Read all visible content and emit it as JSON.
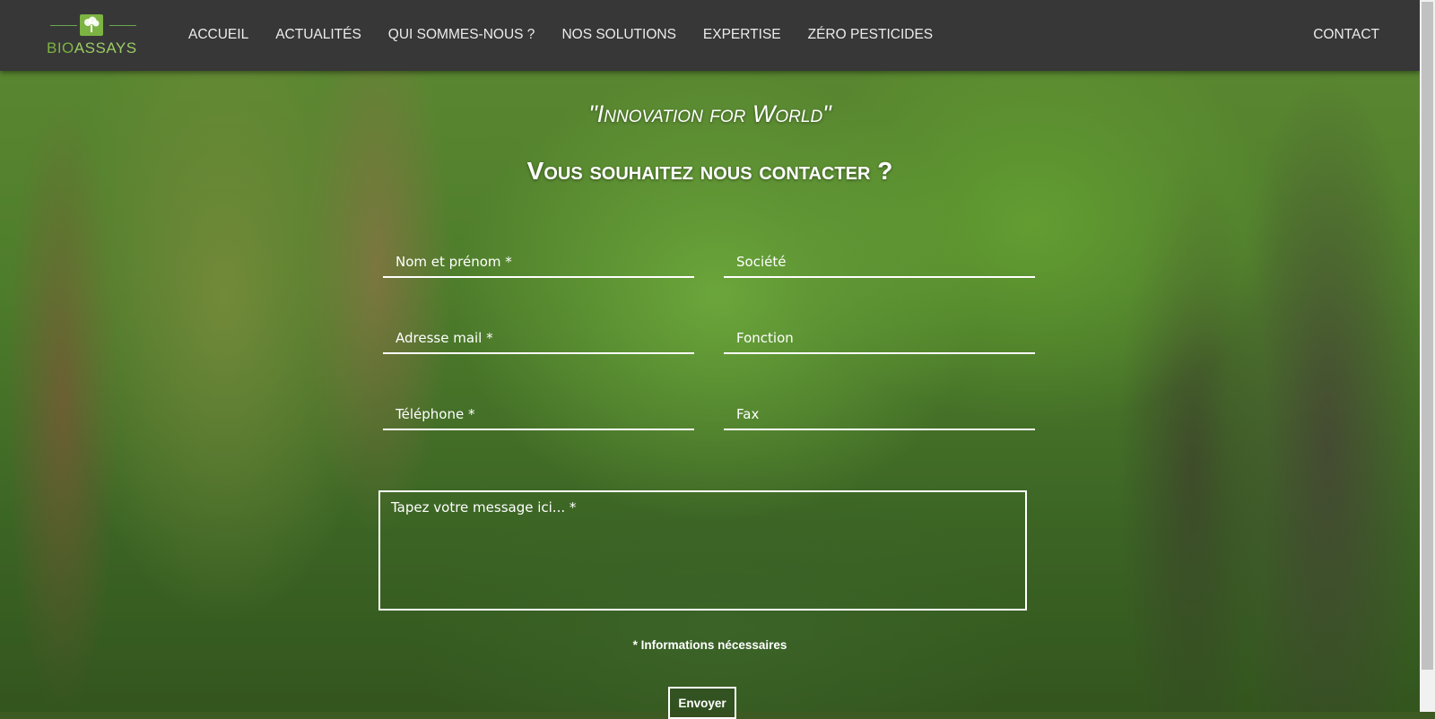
{
  "brand": {
    "logo_text_part1": "BIO",
    "logo_text_part2": "ASSAYS",
    "logo_color": "#7cb342"
  },
  "nav": {
    "items": [
      {
        "label": "ACCUEIL"
      },
      {
        "label": "ACTUALITÉS"
      },
      {
        "label": "QUI SOMMES-NOUS ?"
      },
      {
        "label": "NOS SOLUTIONS"
      },
      {
        "label": "EXPERTISE"
      },
      {
        "label": "ZÉRO PESTICIDES"
      }
    ],
    "contact": "CONTACT"
  },
  "hero": {
    "tagline": "\"Innovation for World\"",
    "heading": "Vous souhaitez nous contacter ?"
  },
  "form": {
    "name_placeholder": "Nom et prénom *",
    "company_placeholder": "Société",
    "email_placeholder": "Adresse mail *",
    "position_placeholder": "Fonction",
    "phone_placeholder": "Téléphone *",
    "fax_placeholder": "Fax",
    "message_placeholder": "Tapez votre message ici... *",
    "required_note": "* Informations nécessaires",
    "submit_label": "Envoyer"
  }
}
